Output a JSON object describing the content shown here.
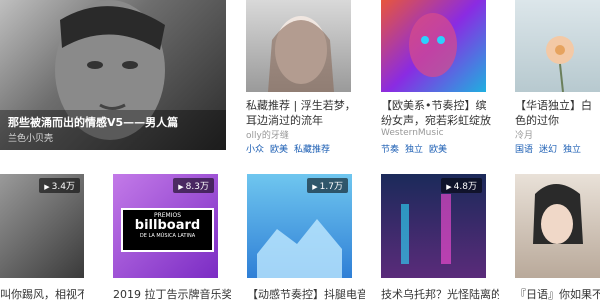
{
  "featured": {
    "title": "那些被涌而出的情感V5——男人篇",
    "author": "兰色小贝壳"
  },
  "top_row": [
    {
      "title": "私藏推荐 | 浮生若梦，耳边淌过的流年",
      "author": "olly的牙缝",
      "tags": [
        "小众",
        "欧美",
        "私藏推荐"
      ]
    },
    {
      "title": "【欧美系•节奏控】缤纷女声，宛若彩虹绽放般五...",
      "author": "WesternMusic",
      "tags": [
        "节奏",
        "独立",
        "欧美"
      ]
    },
    {
      "title": "【华语独立】白色的过你",
      "author": "冷月",
      "tags": [
        "国语",
        "迷幻",
        "独立"
      ]
    }
  ],
  "bottom_row": [
    {
      "count": "3.4万",
      "title": "叫你踢风，相视不"
    },
    {
      "count": "8.3万",
      "title": "2019 拉丁告示牌音乐奖",
      "cover_text": {
        "premios": "PREMIOS",
        "billboard": "billboard",
        "sub": "DE LA MÚSICA LATINA"
      }
    },
    {
      "count": "1.7万",
      "title": "【动感节奏控】抖腿电音"
    },
    {
      "count": "4.8万",
      "title": "技术乌托邦？光怪陆离的"
    },
    {
      "count": "",
      "title": "『日语』你如果不在"
    }
  ],
  "colors": {
    "tag_blue": "#1d5fb4"
  }
}
